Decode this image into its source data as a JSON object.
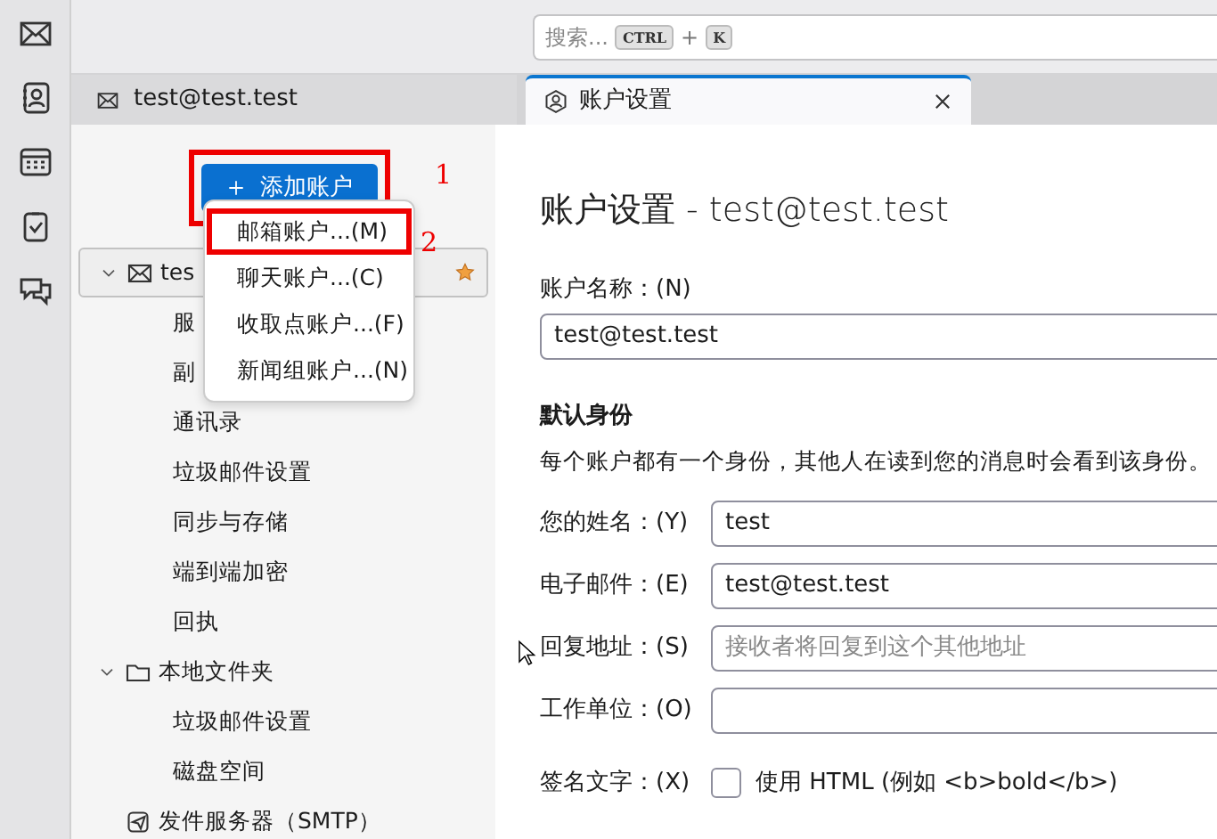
{
  "search": {
    "placeholder": "搜索...",
    "keys": [
      "CTRL",
      "K"
    ],
    "joiner": "+"
  },
  "folder_pane": {
    "title": "test@test.test",
    "add_button": "添加账户"
  },
  "tab": {
    "label": "账户设置",
    "selected": true
  },
  "tree": [
    {
      "kind": "account",
      "label": "tes",
      "expanded": true,
      "selected": true,
      "children": [
        {
          "label": "服"
        },
        {
          "label": "副"
        },
        {
          "label": "通讯录"
        },
        {
          "label": "垃圾邮件设置"
        },
        {
          "label": "同步与存储"
        },
        {
          "label": "端到端加密"
        },
        {
          "label": "回执"
        }
      ]
    },
    {
      "kind": "folder",
      "label": "本地文件夹",
      "expanded": true,
      "selected": false,
      "children": [
        {
          "label": "垃圾邮件设置"
        },
        {
          "label": "磁盘空间"
        }
      ]
    },
    {
      "kind": "smtp",
      "label": "发件服务器（SMTP）",
      "selected": false
    }
  ],
  "menu": [
    {
      "label": "邮箱账户...(M)",
      "highlighted": true
    },
    {
      "label": "聊天账户...(C)",
      "highlighted": false
    },
    {
      "label": "收取点账户...(F)",
      "highlighted": false
    },
    {
      "label": "新闻组账户...(N)",
      "highlighted": false
    }
  ],
  "annotations": [
    {
      "label": "1"
    },
    {
      "label": "2"
    }
  ],
  "settings": {
    "title": "账户设置 - test@test.test",
    "account_name": {
      "label": "账户名称：(N)",
      "value": "test@test.test"
    },
    "identity_heading": "默认身份",
    "identity_note": "每个账户都有一个身份，其他人在读到您的消息时会看到该身份。",
    "fields": [
      {
        "label": "您的姓名：(Y)",
        "value": "test"
      },
      {
        "label": "电子邮件：(E)",
        "value": "test@test.test"
      },
      {
        "label": "回复地址：(S)",
        "placeholder": "接收者将回复到这个其他地址"
      },
      {
        "label": "工作单位：(O)"
      }
    ],
    "signature": {
      "label": "签名文字：(X)",
      "checkbox_label": "使用 HTML (例如 <b>bold</b>)",
      "checked": false
    }
  }
}
